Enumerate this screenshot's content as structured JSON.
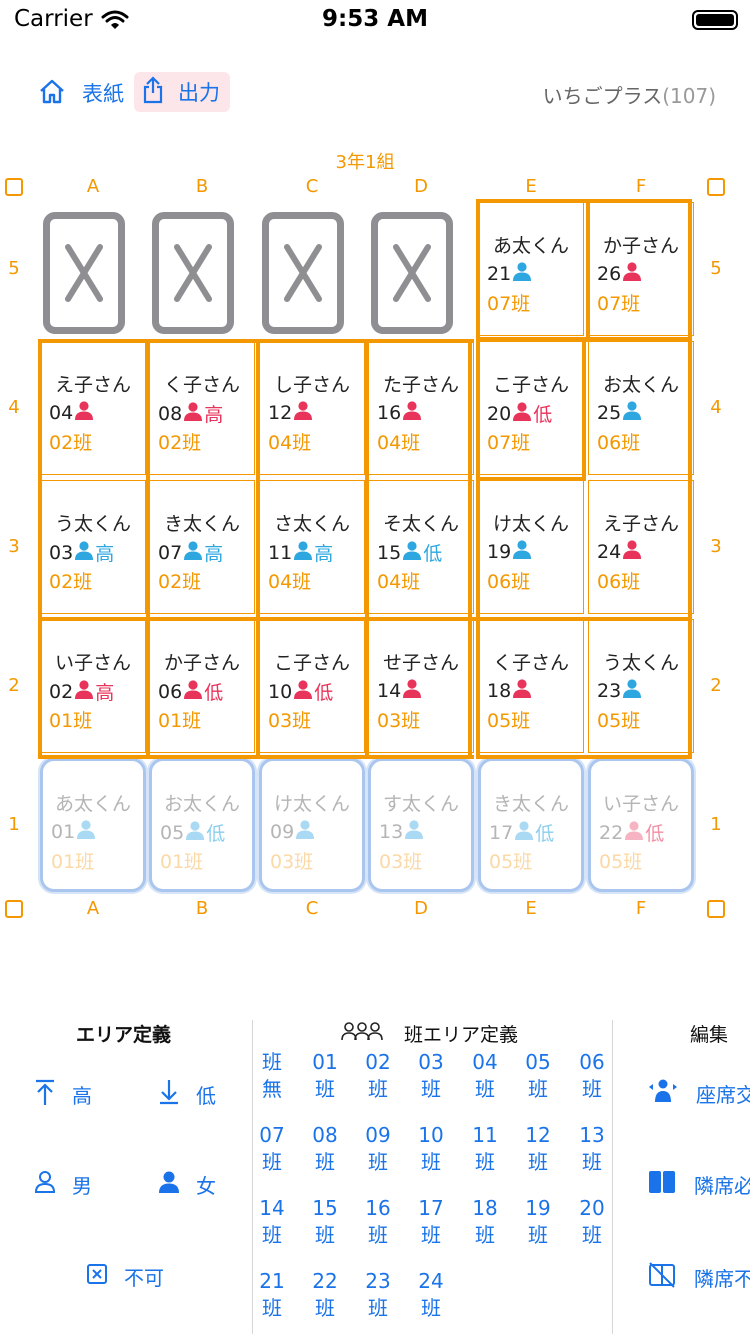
{
  "status_bar": {
    "carrier": "Carrier",
    "time": "9:53 AM"
  },
  "nav": {
    "cover_label": "表紙",
    "export_label": "出力",
    "app_name": "いちごプラス",
    "count": "(107)"
  },
  "classroom": {
    "title": "3年1組",
    "columns": [
      "A",
      "B",
      "C",
      "D",
      "E",
      "F"
    ],
    "rows": [
      "5",
      "4",
      "3",
      "2",
      "1"
    ]
  },
  "colors": {
    "accent": "#f39800",
    "link": "#1a73e8",
    "male": "#2ea7e0",
    "female": "#e8335a",
    "blocked": "#8e8e93"
  },
  "seats": [
    {
      "col": "A",
      "row": "5",
      "blocked": true
    },
    {
      "col": "B",
      "row": "5",
      "blocked": true
    },
    {
      "col": "C",
      "row": "5",
      "blocked": true
    },
    {
      "col": "D",
      "row": "5",
      "blocked": true
    },
    {
      "col": "E",
      "row": "5",
      "name": "あ太くん",
      "num": "21",
      "sex": "male",
      "level": "",
      "group": "07班"
    },
    {
      "col": "F",
      "row": "5",
      "name": "か子さん",
      "num": "26",
      "sex": "female",
      "level": "",
      "group": "07班"
    },
    {
      "col": "A",
      "row": "4",
      "name": "え子さん",
      "num": "04",
      "sex": "female",
      "level": "",
      "group": "02班"
    },
    {
      "col": "B",
      "row": "4",
      "name": "く子さん",
      "num": "08",
      "sex": "female",
      "level": "高",
      "group": "02班"
    },
    {
      "col": "C",
      "row": "4",
      "name": "し子さん",
      "num": "12",
      "sex": "female",
      "level": "",
      "group": "04班"
    },
    {
      "col": "D",
      "row": "4",
      "name": "た子さん",
      "num": "16",
      "sex": "female",
      "level": "",
      "group": "04班"
    },
    {
      "col": "E",
      "row": "4",
      "name": "こ子さん",
      "num": "20",
      "sex": "female",
      "level": "低",
      "group": "07班"
    },
    {
      "col": "F",
      "row": "4",
      "name": "お太くん",
      "num": "25",
      "sex": "male",
      "level": "",
      "group": "06班"
    },
    {
      "col": "A",
      "row": "3",
      "name": "う太くん",
      "num": "03",
      "sex": "male",
      "level": "高",
      "group": "02班"
    },
    {
      "col": "B",
      "row": "3",
      "name": "き太くん",
      "num": "07",
      "sex": "male",
      "level": "高",
      "group": "02班"
    },
    {
      "col": "C",
      "row": "3",
      "name": "さ太くん",
      "num": "11",
      "sex": "male",
      "level": "高",
      "group": "04班"
    },
    {
      "col": "D",
      "row": "3",
      "name": "そ太くん",
      "num": "15",
      "sex": "male",
      "level": "低",
      "group": "04班"
    },
    {
      "col": "E",
      "row": "3",
      "name": "け太くん",
      "num": "19",
      "sex": "male",
      "level": "",
      "group": "06班"
    },
    {
      "col": "F",
      "row": "3",
      "name": "え子さん",
      "num": "24",
      "sex": "female",
      "level": "",
      "group": "06班"
    },
    {
      "col": "A",
      "row": "2",
      "name": "い子さん",
      "num": "02",
      "sex": "female",
      "level": "高",
      "group": "01班"
    },
    {
      "col": "B",
      "row": "2",
      "name": "か子さん",
      "num": "06",
      "sex": "female",
      "level": "低",
      "group": "01班"
    },
    {
      "col": "C",
      "row": "2",
      "name": "こ子さん",
      "num": "10",
      "sex": "female",
      "level": "低",
      "group": "03班"
    },
    {
      "col": "D",
      "row": "2",
      "name": "せ子さん",
      "num": "14",
      "sex": "female",
      "level": "",
      "group": "03班"
    },
    {
      "col": "E",
      "row": "2",
      "name": "く子さん",
      "num": "18",
      "sex": "female",
      "level": "",
      "group": "05班"
    },
    {
      "col": "F",
      "row": "2",
      "name": "う太くん",
      "num": "23",
      "sex": "male",
      "level": "",
      "group": "05班"
    },
    {
      "col": "A",
      "row": "1",
      "name": "あ太くん",
      "num": "01",
      "sex": "male",
      "level": "",
      "group": "01班",
      "faded": true
    },
    {
      "col": "B",
      "row": "1",
      "name": "お太くん",
      "num": "05",
      "sex": "male",
      "level": "低",
      "group": "01班",
      "faded": true
    },
    {
      "col": "C",
      "row": "1",
      "name": "け太くん",
      "num": "09",
      "sex": "male",
      "level": "",
      "group": "03班",
      "faded": true
    },
    {
      "col": "D",
      "row": "1",
      "name": "す太くん",
      "num": "13",
      "sex": "male",
      "level": "",
      "group": "03班",
      "faded": true
    },
    {
      "col": "E",
      "row": "1",
      "name": "き太くん",
      "num": "17",
      "sex": "male",
      "level": "低",
      "group": "05班",
      "faded": true
    },
    {
      "col": "F",
      "row": "1",
      "name": "い子さん",
      "num": "22",
      "sex": "female",
      "level": "低",
      "group": "05班",
      "faded": true
    }
  ],
  "area_definition": {
    "title": "エリア定義",
    "items": [
      {
        "label": "高",
        "icon": "arrow-up-icon"
      },
      {
        "label": "低",
        "icon": "arrow-down-icon"
      },
      {
        "label": "男",
        "icon": "person-outline-icon"
      },
      {
        "label": "女",
        "icon": "person-filled-icon"
      },
      {
        "label": "不可",
        "icon": "x-square-icon"
      }
    ]
  },
  "group_area": {
    "title": "班エリア定義",
    "buttons": [
      [
        "班",
        "無"
      ],
      [
        "01",
        "班"
      ],
      [
        "02",
        "班"
      ],
      [
        "03",
        "班"
      ],
      [
        "04",
        "班"
      ],
      [
        "05",
        "班"
      ],
      [
        "06",
        "班"
      ],
      [
        "07",
        "班"
      ],
      [
        "08",
        "班"
      ],
      [
        "09",
        "班"
      ],
      [
        "10",
        "班"
      ],
      [
        "11",
        "班"
      ],
      [
        "12",
        "班"
      ],
      [
        "13",
        "班"
      ],
      [
        "14",
        "班"
      ],
      [
        "15",
        "班"
      ],
      [
        "16",
        "班"
      ],
      [
        "17",
        "班"
      ],
      [
        "18",
        "班"
      ],
      [
        "19",
        "班"
      ],
      [
        "20",
        "班"
      ],
      [
        "21",
        "班"
      ],
      [
        "22",
        "班"
      ],
      [
        "23",
        "班"
      ],
      [
        "24",
        "班"
      ]
    ]
  },
  "edit": {
    "title": "編集",
    "items": [
      {
        "label": "座席交",
        "icon": "swap-people-icon"
      },
      {
        "label": "隣席必",
        "icon": "split-square-icon"
      },
      {
        "label": "隣席不",
        "icon": "split-square-slash-icon"
      }
    ]
  }
}
